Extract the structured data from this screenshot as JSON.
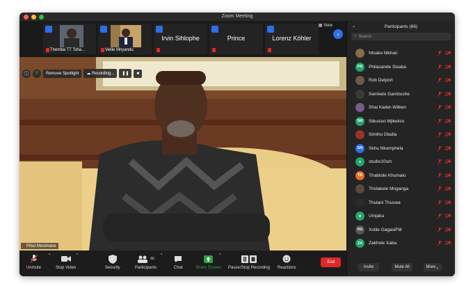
{
  "window": {
    "title": "Zoom Meeting"
  },
  "colors": {
    "accent": "#2d6fe6",
    "danger": "#e02828",
    "share": "#2ea043"
  },
  "strip": {
    "tiles": [
      {
        "name": "Themba TT Tsha...",
        "type": "photo"
      },
      {
        "name": "Velile Mnyandu",
        "type": "photo"
      },
      {
        "name": "Irvin Sihlophe",
        "type": "name"
      },
      {
        "name": "Prince",
        "type": "name"
      },
      {
        "name": "Lorenz Köhler",
        "type": "name"
      }
    ],
    "view_label": "View"
  },
  "video": {
    "remove_spotlight": "Remove Spotlight",
    "recording": "Recording...",
    "speaker_name": "Pitso Mosimane"
  },
  "toolbar": {
    "unmute": "Unmute",
    "stop_video": "Stop Video",
    "security": "Security",
    "participants": "Participants",
    "participants_count": "66",
    "chat": "Chat",
    "share_screen": "Share Screen",
    "pause_stop_recording": "Pause/Stop Recording",
    "reactions": "Reactions",
    "end": "End"
  },
  "panel": {
    "title": "Participants (66)",
    "search_placeholder": "Search",
    "participants": [
      {
        "name": "Ntsako Mkhari",
        "initials": "",
        "color": "#8a6a4a",
        "icon": "photo"
      },
      {
        "name": "Philasande Sixaba",
        "initials": "PS",
        "color": "#23a26d",
        "icon": "initials"
      },
      {
        "name": "Rob Delport",
        "initials": "",
        "color": "#6f5a4a",
        "icon": "photo"
      },
      {
        "name": "Samkelo Gambushe",
        "initials": "",
        "color": "#3a3a3a",
        "icon": "photo"
      },
      {
        "name": "Shai Kader-Wilken",
        "initials": "",
        "color": "#7a5a8a",
        "icon": "photo"
      },
      {
        "name": "Sibusiso Mjikeliso",
        "initials": "SM",
        "color": "#23a26d",
        "icon": "initials"
      },
      {
        "name": "Simtho Dladla",
        "initials": "",
        "color": "#a0302a",
        "icon": "photo"
      },
      {
        "name": "Skhu Nkomphela",
        "initials": "SN",
        "color": "#2d6fe6",
        "icon": "initials"
      },
      {
        "name": "studio10sm",
        "initials": "s",
        "color": "#23a26d",
        "icon": "initials"
      },
      {
        "name": "Thabisile Khumalo",
        "initials": "TK",
        "color": "#e3702a",
        "icon": "initials"
      },
      {
        "name": "Tholakele Mnganga",
        "initials": "",
        "color": "#5a4a3a",
        "icon": "photo"
      },
      {
        "name": "Thulani Thuswa",
        "initials": "",
        "color": "#2a2a2a",
        "icon": "photo"
      },
      {
        "name": "Umjaka",
        "initials": "U",
        "color": "#23a26d",
        "icon": "initials"
      },
      {
        "name": "Xolile GagasiFM",
        "initials": "XG",
        "color": "#555555",
        "icon": "initials"
      },
      {
        "name": "Zakhele Xaba",
        "initials": "ZX",
        "color": "#23a26d",
        "icon": "initials"
      }
    ],
    "invite": "Invite",
    "mute_all": "Mute All",
    "more": "More"
  }
}
